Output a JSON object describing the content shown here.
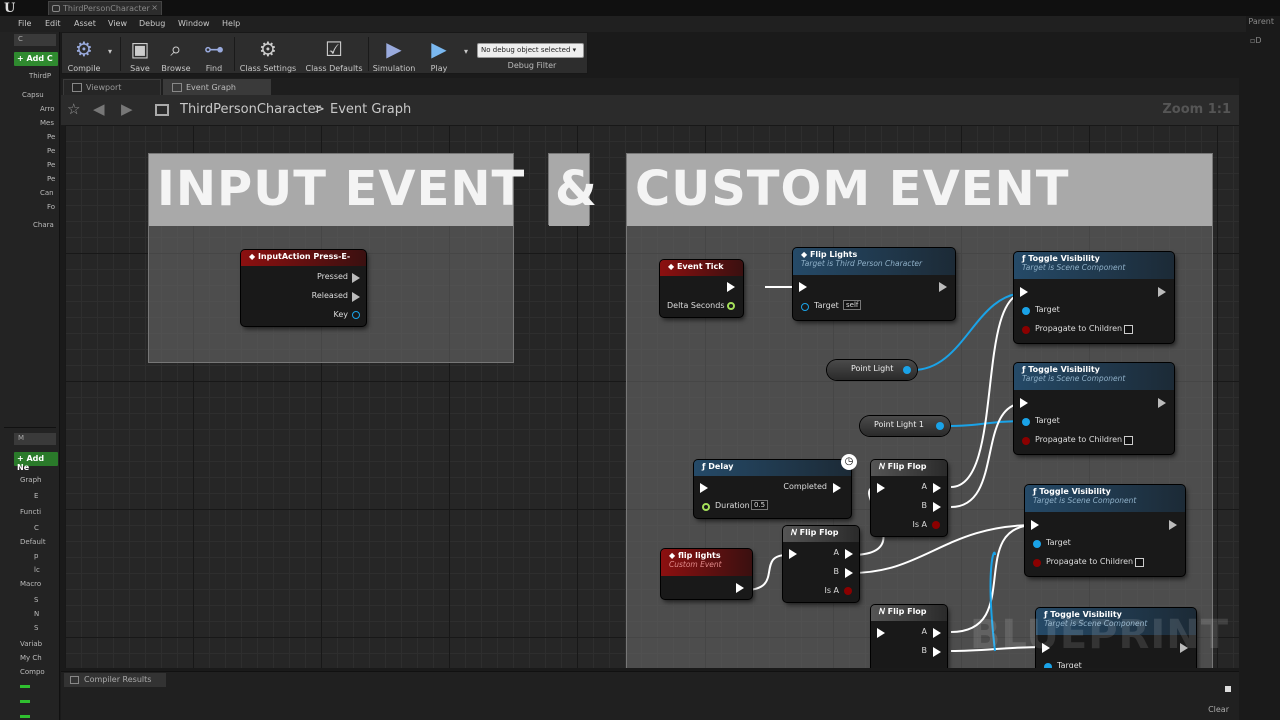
{
  "window": {
    "doc_tab": "ThirdPersonCharacter",
    "parent_label": "Parent"
  },
  "menu": [
    "File",
    "Edit",
    "Asset",
    "View",
    "Debug",
    "Window",
    "Help"
  ],
  "left_panel": {
    "components_header": "C",
    "add_component": "+ Add C",
    "tree": [
      "ThirdP",
      "Capsu",
      "Arro",
      "Mes",
      "Pe",
      "Pe",
      "Pe",
      "Pe",
      "Can",
      "Fo",
      "Chara"
    ],
    "mybp_header": "M",
    "add_new": "+ Add Ne",
    "sections": [
      "Graph",
      "E",
      "Functi",
      "C",
      "Default",
      "p",
      "lc",
      "Macro",
      "S",
      "N",
      "S",
      "Variab",
      "My Ch",
      "Compo"
    ]
  },
  "toolbar": {
    "buttons": [
      {
        "label": "Compile",
        "icon": "gear-check-icon"
      },
      {
        "label": "Save",
        "icon": "floppy-icon"
      },
      {
        "label": "Browse",
        "icon": "magnifier-icon"
      },
      {
        "label": "Find",
        "icon": "binoculars-icon"
      },
      {
        "label": "Class Settings",
        "icon": "gears-icon"
      },
      {
        "label": "Class Defaults",
        "icon": "checklist-icon"
      },
      {
        "label": "Simulation",
        "icon": "simulate-icon"
      },
      {
        "label": "Play",
        "icon": "play-icon"
      }
    ],
    "debug_object": "No debug object selected ▾",
    "debug_filter": "Debug Filter"
  },
  "editor_tabs": [
    "Viewport",
    "Event Graph"
  ],
  "breadcrumb": {
    "root": "ThirdPersonCharacter",
    "sep": ">",
    "current": "Event Graph",
    "zoom": "Zoom 1:1"
  },
  "graph": {
    "comments": [
      "INPUT EVENT",
      "&",
      "CUSTOM EVENT"
    ],
    "nodes": {
      "input_action": {
        "title": "InputAction Press-E-",
        "pins": [
          "Pressed",
          "Released",
          "Key"
        ]
      },
      "event_tick": {
        "title": "Event Tick",
        "pin": "Delta Seconds"
      },
      "flip_lights": {
        "title": "Flip Lights",
        "sub": "Target is Third Person Character",
        "target": "Target",
        "self": "self"
      },
      "toggle_vis": {
        "title": "Toggle Visibility",
        "sub": "Target is Scene Component",
        "target": "Target",
        "propagate": "Propagate to Children"
      },
      "point_light": "Point Light",
      "point_light_1": "Point Light 1",
      "delay": {
        "title": "Delay",
        "completed": "Completed",
        "duration": "Duration",
        "duration_val": "0.5"
      },
      "flip_flop": {
        "title": "Flip Flop",
        "a": "A",
        "b": "B",
        "isa": "Is A"
      },
      "custom_event": {
        "title": "flip lights",
        "sub": "Custom Event"
      }
    },
    "watermark": "BLUEPRINT"
  },
  "compiler": {
    "tab": "Compiler Results",
    "clear": "Clear"
  },
  "colors": {
    "exec": "#ffffff",
    "object_pin": "#1aa3e8",
    "bool_pin": "#8b0000",
    "float_pin": "#a5e05a",
    "event_header": "#8c1010",
    "function_header": "#254a68"
  }
}
